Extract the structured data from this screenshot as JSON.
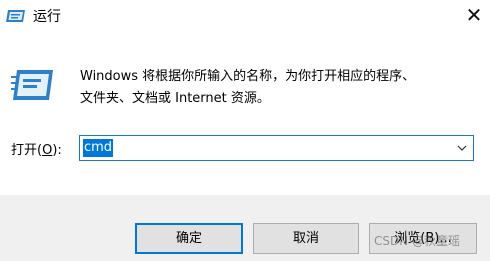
{
  "window": {
    "title": "运行",
    "close_glyph": "✕"
  },
  "description": "Windows 将根据你所输入的名称，为你打开相应的程序、\n文件夹、文档或 Internet 资源。",
  "open_field": {
    "label_prefix": "打开(",
    "label_accel": "O",
    "label_suffix": "):",
    "value": "cmd"
  },
  "buttons": {
    "ok": "确定",
    "cancel": "取消",
    "browse": "浏览(B)..."
  },
  "watermark": "CSDN @秋童瑶",
  "colors": {
    "accent": "#0078d7",
    "footer": "#f0f0f0",
    "button_bg": "#e1e1e1"
  },
  "icons": {
    "title": "run-icon",
    "body": "run-large-icon",
    "close": "close-icon",
    "dropdown": "chevron-down-icon"
  }
}
